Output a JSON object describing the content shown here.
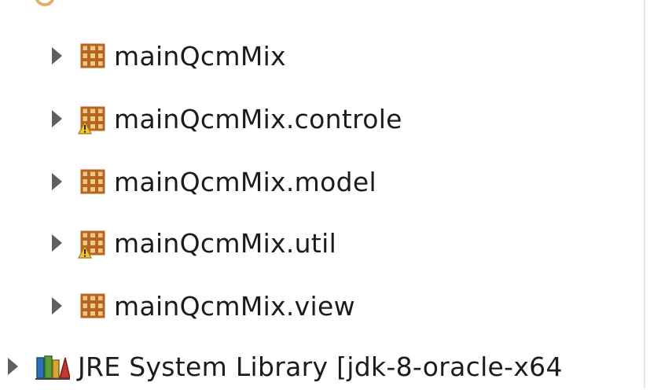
{
  "tree": {
    "packages": [
      {
        "label": "mainQcmMix",
        "icon": "package-icon",
        "warning": false
      },
      {
        "label": "mainQcmMix.controle",
        "icon": "package-icon",
        "warning": true
      },
      {
        "label": "mainQcmMix.model",
        "icon": "package-icon",
        "warning": false
      },
      {
        "label": "mainQcmMix.util",
        "icon": "package-icon",
        "warning": true
      },
      {
        "label": "mainQcmMix.view",
        "icon": "package-icon",
        "warning": false
      }
    ],
    "library": {
      "label": "JRE System Library [jdk-8-oracle-x64",
      "icon": "library-icon"
    }
  },
  "colors": {
    "package_brown": "#b5651d",
    "package_light": "#f0c98a",
    "warning_yellow": "#f4c430",
    "twisty_gray": "#5f5f5f"
  }
}
